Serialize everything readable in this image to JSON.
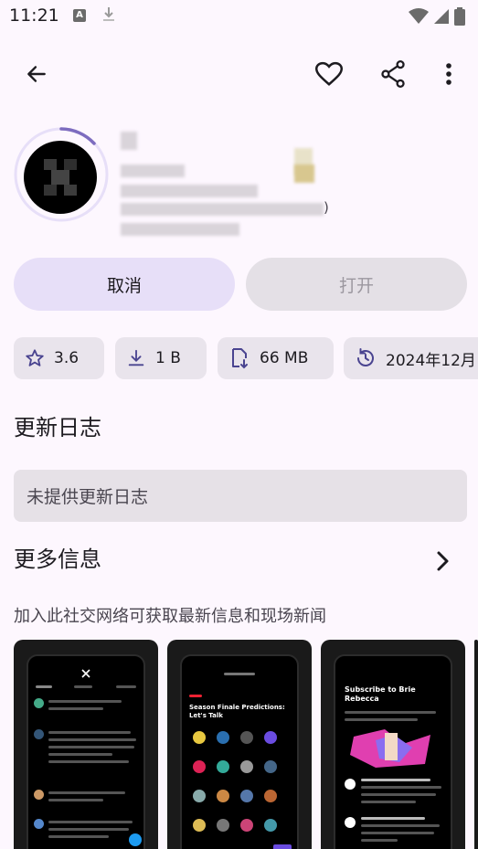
{
  "status_bar": {
    "time": "11:21",
    "a_icon": "A"
  },
  "header": {
    "back_icon": "arrow-back-icon",
    "favorite_icon": "heart-outline-icon",
    "share_icon": "share-icon",
    "more_icon": "more-vert-icon"
  },
  "actions": {
    "cancel_label": "取消",
    "open_label": "打开"
  },
  "chips": {
    "rating": "3.6",
    "downloads": "1 B",
    "size": "66 MB",
    "updated": "2024年12月"
  },
  "changelog": {
    "title": "更新日志",
    "empty_text": "未提供更新日志"
  },
  "more_info": {
    "title": "更多信息",
    "description": "加入此社交网络可获取最新信息和现场新闻"
  },
  "screenshots": {
    "shot2_title": "Season Finale Predictions: Let's Talk",
    "shot3_title": "Subscribe to Brie Rebecca"
  },
  "colors": {
    "accent": "#7d6cbf",
    "button_tonal": "#e7dff8",
    "background": "#fdf7fe"
  }
}
